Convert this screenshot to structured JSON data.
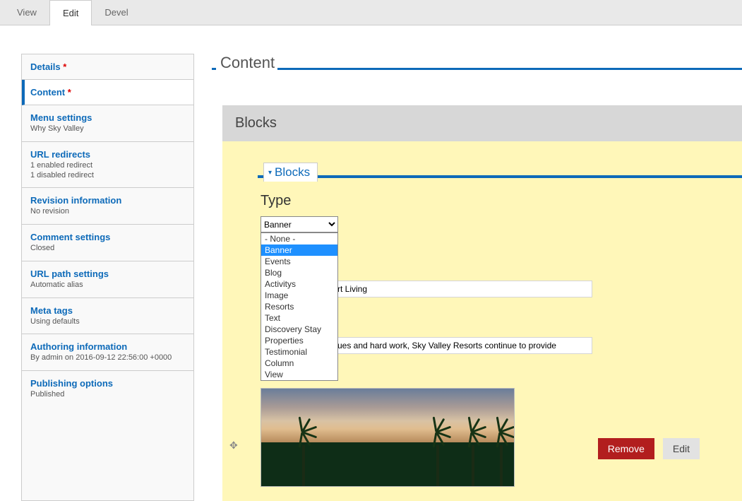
{
  "top_tabs": {
    "view": "View",
    "edit": "Edit",
    "devel": "Devel"
  },
  "sidebar": {
    "details": "Details",
    "content": "Content",
    "menu_settings": {
      "title": "Menu settings",
      "sub": "Why Sky Valley"
    },
    "url_redirects": {
      "title": "URL redirects",
      "sub": "1 enabled redirect\n1 disabled redirect"
    },
    "revision": {
      "title": "Revision information",
      "sub": "No revision"
    },
    "comment": {
      "title": "Comment settings",
      "sub": "Closed"
    },
    "url_path": {
      "title": "URL path settings",
      "sub": "Automatic alias"
    },
    "meta": {
      "title": "Meta tags",
      "sub": "Using defaults"
    },
    "authoring": {
      "title": "Authoring information",
      "sub": "By admin on 2016-09-12 22:56:00 +0000"
    },
    "publishing": {
      "title": "Publishing options",
      "sub": "Published"
    }
  },
  "content": {
    "section_title": "Content",
    "blocks_header": "Blocks",
    "inner_legend": "Blocks",
    "type_label": "Type",
    "type_selected": "Banner",
    "type_options": [
      "- None -",
      "Banner",
      "Events",
      "Blog",
      "Activitys",
      "Image",
      "Resorts",
      "Text",
      "Discovery Stay",
      "Properties",
      "Testimonial",
      "Column",
      "View"
    ],
    "field1_visible": "rt Living",
    "field2_visible": "ues and hard work, Sky Valley Resorts continue to provide",
    "remove_label": "Remove",
    "edit_label": "Edit"
  }
}
